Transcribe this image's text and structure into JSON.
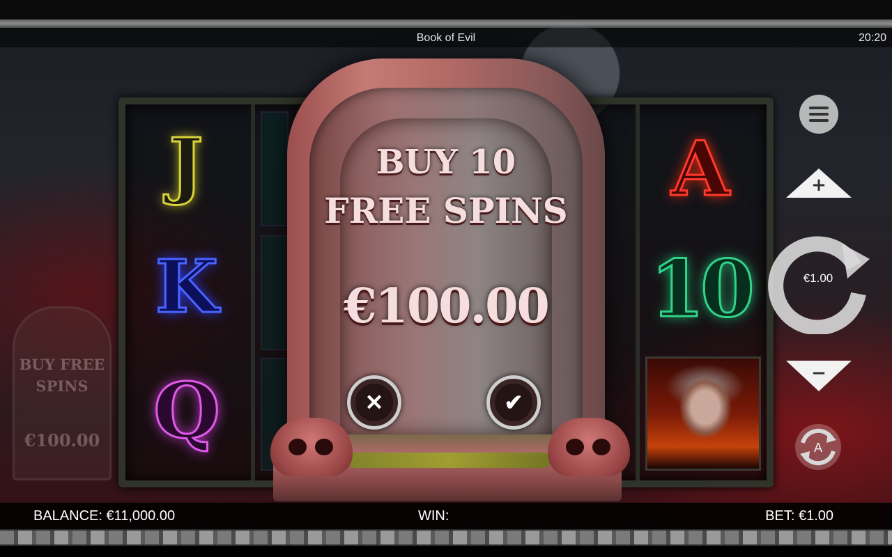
{
  "header": {
    "title": "Book of Evil",
    "clock": "20:20"
  },
  "reels": {
    "symbols": [
      "J",
      "K",
      "Q",
      "A",
      "10"
    ]
  },
  "side_panel": {
    "buy_label_line1": "BUY FREE",
    "buy_label_line2": "SPINS",
    "price": "€100.00"
  },
  "dialog": {
    "title_line1": "BUY 10",
    "title_line2": "FREE SPINS",
    "price": "€100.00",
    "cancel_glyph": "✕",
    "confirm_glyph": "✔"
  },
  "controls": {
    "spin_bet_label": "€1.00",
    "bet_up_glyph": "+",
    "bet_down_glyph": "−",
    "auto_glyph": "A",
    "icons": [
      "menu-icon",
      "plus-icon",
      "minus-icon",
      "spin-icon",
      "autoplay-icon"
    ]
  },
  "footer": {
    "balance": "BALANCE: €11,000.00",
    "win": "WIN:",
    "bet": "BET: €1.00"
  },
  "colors": {
    "j": "#d8d33a",
    "k": "#4a64ff",
    "q": "#e05ae8",
    "a": "#ff3a2a",
    "ten": "#32d28a"
  }
}
